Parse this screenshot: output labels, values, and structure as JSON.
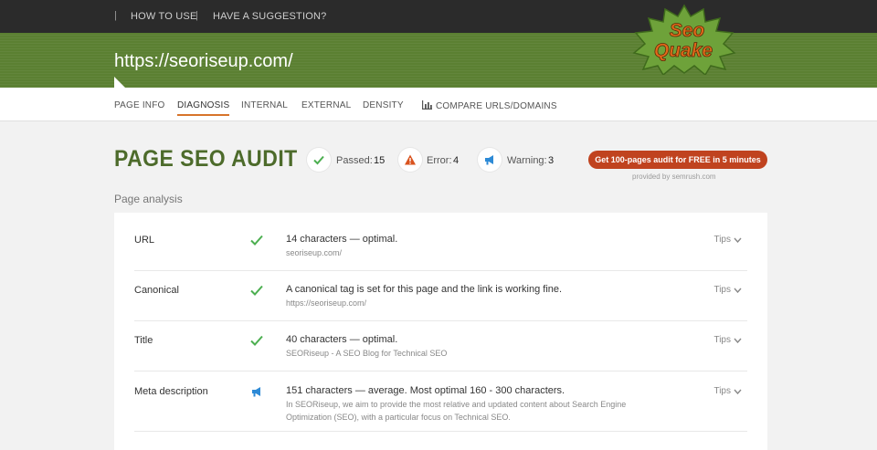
{
  "topbar": {
    "links": [
      {
        "label": "HOW TO USE"
      },
      {
        "label": "HAVE A SUGGESTION?"
      }
    ],
    "separator": "|"
  },
  "header": {
    "url": "https://seoriseup.com/",
    "logo_text_top": "Seo",
    "logo_text_bottom": "Quake"
  },
  "nav": {
    "tabs": [
      {
        "label": "PAGE INFO"
      },
      {
        "label": "DIAGNOSIS",
        "active": true
      },
      {
        "label": "INTERNAL"
      },
      {
        "label": "EXTERNAL"
      },
      {
        "label": "DENSITY"
      },
      {
        "label": "COMPARE URLS/DOMAINS",
        "icon": "bar-chart-icon"
      }
    ]
  },
  "audit": {
    "title": "PAGE SEO AUDIT",
    "passed_label": "Passed:",
    "passed_value": "15",
    "error_label": "Error:",
    "error_value": "4",
    "warning_label": "Warning:",
    "warning_value": "3",
    "cta_label": "Get 100-pages audit for FREE in 5 minutes",
    "cta_sub": "provided by  semrush.com",
    "section_label": "Page analysis"
  },
  "colors": {
    "brand_green": "#5b8032",
    "title_green": "#4d6b2b",
    "accent_orange": "#d7742b",
    "cta_red": "#c0431f",
    "pass_green": "#4caf50",
    "error_orange": "#d9531e",
    "warning_blue": "#2d8ad6"
  },
  "rows": [
    {
      "name": "URL",
      "status": "check-icon",
      "message": "14 characters — optimal.",
      "detail": "seoriseup.com/",
      "tips": "Tips"
    },
    {
      "name": "Canonical",
      "status": "check-icon",
      "message": "A canonical tag is set for this page and the link is working fine.",
      "detail": "https://seoriseup.com/",
      "tips": "Tips"
    },
    {
      "name": "Title",
      "status": "check-icon",
      "message": "40 characters — optimal.",
      "detail": "SEORiseup - A SEO Blog for Technical SEO",
      "tips": "Tips"
    },
    {
      "name": "Meta description",
      "status": "megaphone-icon",
      "message": "151 characters — average. Most optimal 160 - 300 characters.",
      "detail": "In SEORiseup, we aim to provide the most relative and updated content about Search Engine Optimization (SEO), with a particular focus on Technical SEO.",
      "tips": "Tips"
    }
  ]
}
